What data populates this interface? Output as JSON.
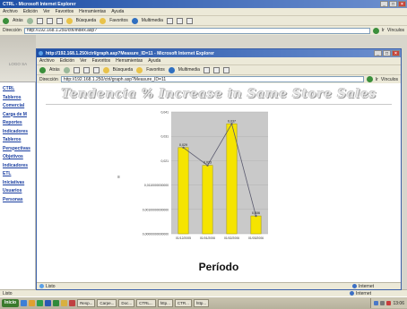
{
  "outer": {
    "title": "CTRL - Microsoft Internet Explorer",
    "menu": [
      "Archivo",
      "Edición",
      "Ver",
      "Favoritos",
      "Herramientas",
      "Ayuda"
    ],
    "toolbar": {
      "back": "Atrás",
      "search": "Búsqueda",
      "favorites": "Favoritos",
      "multimedia": "Multimedia"
    },
    "address_label": "Dirección",
    "address": "http://192.168.1.250/ctrl/index.asp?",
    "go": "Ir",
    "links": "Vínculos",
    "logo": "LOGO SA"
  },
  "inner": {
    "title": "http://192.168.1.250/ctrl/graph.asp?Measure_ID=11 - Microsoft Internet Explorer",
    "menu": [
      "Archivo",
      "Edición",
      "Ver",
      "Favoritos",
      "Herramientas",
      "Ayuda"
    ],
    "toolbar": {
      "back": "Atrás",
      "search": "Búsqueda",
      "favorites": "Favoritos",
      "multimedia": "Multimedia"
    },
    "address_label": "Dirección",
    "address": "http://192.168.1.250/ctrl/graph.asp?Measure_ID=11",
    "go": "Ir",
    "links": "Vínculos",
    "status": "Listo",
    "zone": "Internet"
  },
  "sidebar": {
    "items": [
      "CTRL",
      "Tableros",
      "Comercial",
      "Carga de M",
      "Reportes",
      "Indicadores",
      "Tableros",
      "Perspectivas",
      "Objetivos",
      "Indicadores",
      "ETL",
      "Iniciativas",
      "Usuarios",
      "Personas"
    ]
  },
  "chart_data": {
    "type": "bar",
    "title": "Tendencia % Increase in Same Store Sales",
    "xlabel": "Período",
    "ylabel": "",
    "categories": [
      "01/12/2005",
      "01/01/2006",
      "01/02/2006",
      "01/03/2006"
    ],
    "values": [
      0.029,
      0.023,
      0.037,
      0.006
    ],
    "value_labels": [
      "0,029",
      "0,023",
      "0,037",
      "0,006"
    ],
    "ytick_labels": [
      "0,041",
      "0,031",
      "0,021",
      "0,0110000000000",
      "0,00100000000000",
      "0,00000000000000"
    ],
    "ylim": [
      0,
      0.041
    ],
    "grid": true,
    "line_overlay": true,
    "colors": {
      "bar": "#f5e400",
      "bar_edge": "#b3a600",
      "plot_bg": "#c9c9c9",
      "line": "#5a5a6e"
    }
  },
  "outer_status": {
    "status": "Listo",
    "zone": "Internet"
  },
  "taskbar": {
    "start": "Inicio",
    "tasks": [
      "Resp...",
      "Carpe...",
      "Doc...",
      "CTRL...",
      "http...",
      "CTR...",
      "http..."
    ],
    "clock": "13:06"
  }
}
